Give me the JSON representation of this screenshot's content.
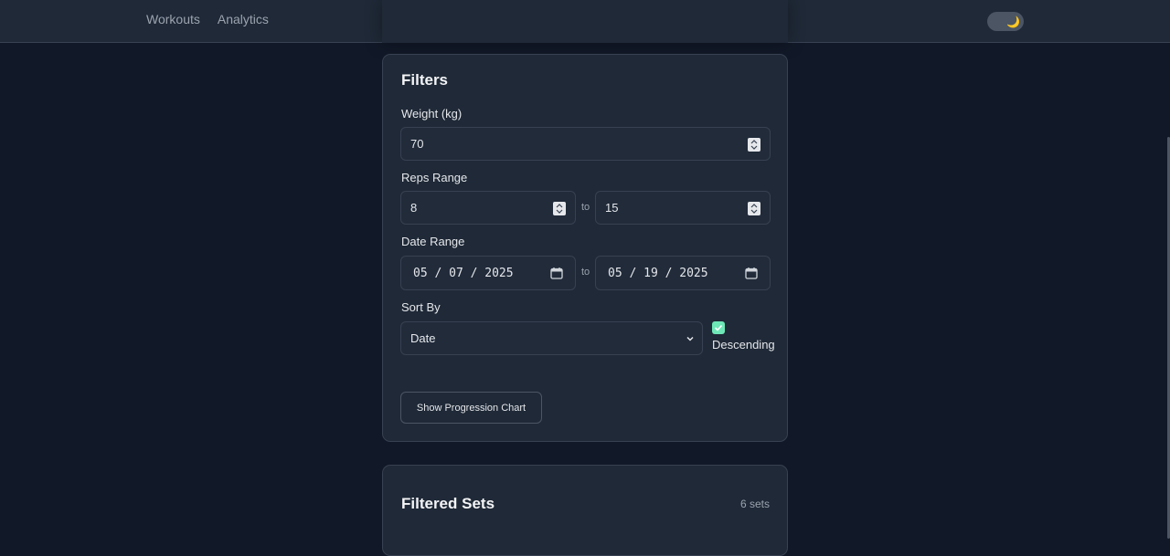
{
  "nav": {
    "items": [
      {
        "label": "Workouts"
      },
      {
        "label": "Analytics"
      }
    ]
  },
  "theme_toggle": {
    "icon": "moon-icon",
    "glyph": "🌙"
  },
  "filters": {
    "title": "Filters",
    "weight": {
      "label": "Weight (kg)",
      "value": "70"
    },
    "reps": {
      "label": "Reps Range",
      "from": "8",
      "to_label": "to",
      "to": "15"
    },
    "date": {
      "label": "Date Range",
      "from": "05 / 07 / 2025",
      "to_label": "to",
      "to": "05 / 19 / 2025"
    },
    "sort": {
      "label": "Sort By",
      "value": "Date",
      "descending_label": "Descending",
      "descending": true
    },
    "chart_button": "Show Progression Chart"
  },
  "filtered_sets": {
    "title": "Filtered Sets",
    "count": "6 sets"
  },
  "colors": {
    "background": "#111827",
    "card": "#1f2937",
    "accent": "#6ee7b7"
  }
}
